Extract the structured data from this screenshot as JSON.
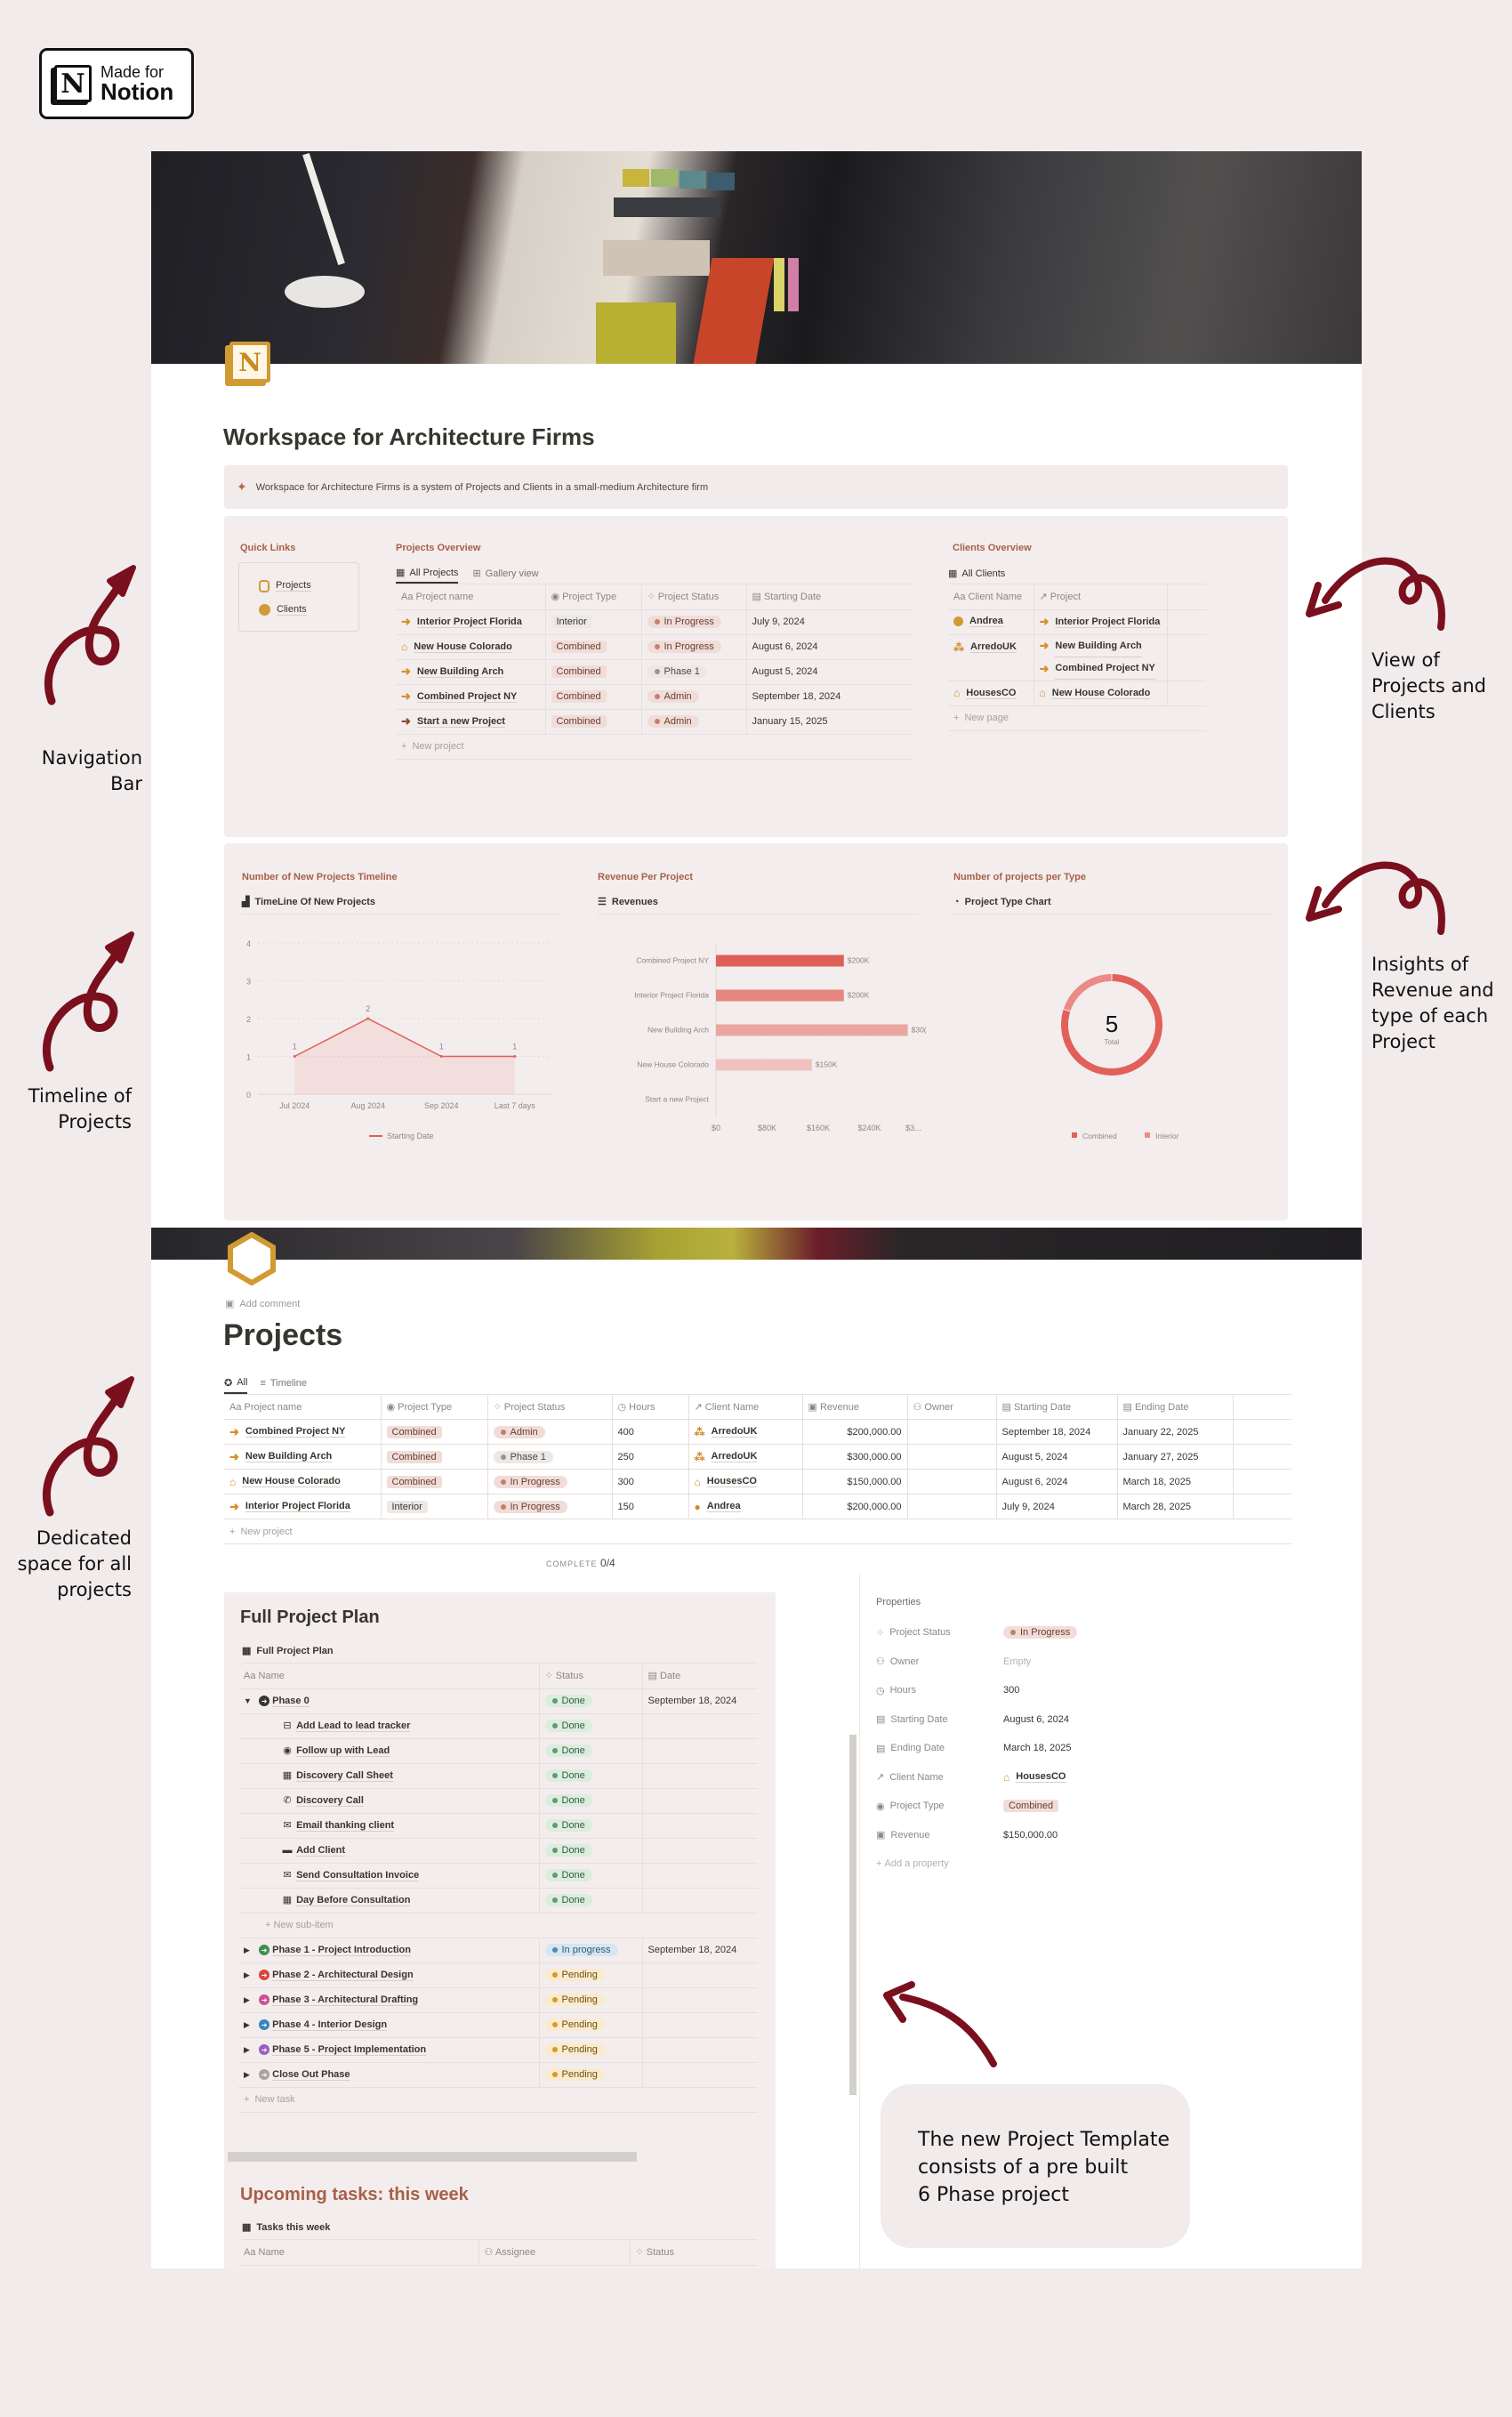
{
  "badge": {
    "line1": "Made for",
    "line2": "Notion",
    "logo": "N"
  },
  "workspace": {
    "page_icon": "N",
    "title": "Workspace for Architecture Firms",
    "callout_icon": "sparkles-icon",
    "callout": "Workspace for Architecture Firms is a system of Projects and Clients in a small-medium Architecture firm",
    "quick_links": {
      "label": "Quick Links",
      "items": [
        {
          "label": "Projects",
          "icon": "hexagon-icon"
        },
        {
          "label": "Clients",
          "icon": "person-icon"
        }
      ]
    },
    "projects_overview": {
      "label": "Projects Overview",
      "tabs": [
        {
          "label": "All Projects",
          "icon": "table-icon",
          "active": true
        },
        {
          "label": "Gallery view",
          "icon": "gallery-icon",
          "active": false
        }
      ],
      "columns": [
        "Project name",
        "Project Type",
        "Project Status",
        "Starting Date"
      ],
      "rows": [
        {
          "name": "Interior Project Florida",
          "icon": "arrow-right-icon",
          "type": "Interior",
          "status": "In Progress",
          "start": "July 9, 2024"
        },
        {
          "name": "New House Colorado",
          "icon": "house-icon",
          "type": "Combined",
          "status": "In Progress",
          "start": "August 6, 2024"
        },
        {
          "name": "New Building Arch",
          "icon": "arrow-right-icon",
          "type": "Combined",
          "status": "Phase 1",
          "start": "August 5, 2024"
        },
        {
          "name": "Combined Project NY",
          "icon": "arrow-right-icon",
          "type": "Combined",
          "status": "Admin",
          "start": "September 18, 2024"
        },
        {
          "name": "Start a new Project",
          "icon": "arrow-right-icon",
          "type": "Combined",
          "status": "Admin",
          "start": "January 15, 2025"
        }
      ],
      "new_label": "New project"
    },
    "clients_overview": {
      "label": "Clients Overview",
      "tab": "All Clients",
      "columns": [
        "Client Name",
        "Project"
      ],
      "rows": [
        {
          "name": "Andrea",
          "icon": "person-icon",
          "projects": [
            "Interior Project Florida"
          ]
        },
        {
          "name": "ArredoUK",
          "icon": "team-icon",
          "projects": [
            "New Building Arch",
            "Combined Project NY"
          ]
        },
        {
          "name": "HousesCO",
          "icon": "home-icon",
          "projects": [
            "New House Colorado"
          ]
        }
      ],
      "new_label": "New page"
    }
  },
  "charts": {
    "timeline": {
      "section": "Number of New Projects Timeline",
      "title": "TimeLine Of New Projects",
      "legend": "Starting Date"
    },
    "revenue": {
      "section": "Revenue Per Project",
      "title": "Revenues"
    },
    "type": {
      "section": "Number of projects per Type",
      "title": "Project Type Chart",
      "center_value": "5",
      "center_label": "Total"
    }
  },
  "chart_data": [
    {
      "type": "area",
      "title": "TimeLine Of New Projects",
      "categories": [
        "Jul 2024",
        "Aug 2024",
        "Sep 2024",
        "Last 7 days"
      ],
      "series": [
        {
          "name": "Starting Date",
          "values": [
            1,
            2,
            1,
            1
          ]
        }
      ],
      "yticks": [
        0,
        1,
        2,
        3,
        4
      ],
      "ylim": [
        0,
        4
      ],
      "grid": true,
      "legend": "bottom",
      "color": "#e2605a"
    },
    {
      "type": "bar",
      "orientation": "horizontal",
      "title": "Revenues",
      "categories": [
        "Combined Project NY",
        "Interior Project Florida",
        "New Building Arch",
        "New House Colorado",
        "Start a new Project"
      ],
      "values": [
        200000,
        200000,
        300000,
        150000,
        0
      ],
      "value_labels": [
        "$200K",
        "$200K",
        "$30(",
        "$150K",
        ""
      ],
      "xticks": [
        "$0",
        "$80K",
        "$160K",
        "$240K",
        "$3..."
      ],
      "xlim": [
        0,
        320000
      ],
      "colors": [
        "#df5f58",
        "#e5877f",
        "#eaa5a0",
        "#f0c2bf",
        "#f3d6d4"
      ]
    },
    {
      "type": "pie",
      "donut": true,
      "title": "Project Type Chart",
      "categories": [
        "Combined",
        "Interior"
      ],
      "values": [
        4,
        1
      ],
      "total": 5,
      "colors": [
        "#e2605a",
        "#ea8b85"
      ],
      "legend": "bottom"
    }
  ],
  "projects_page": {
    "add_comment": "Add comment",
    "title": "Projects",
    "tabs": [
      {
        "label": "All",
        "icon": "star-icon",
        "active": true
      },
      {
        "label": "Timeline",
        "icon": "timeline-icon",
        "active": false
      }
    ],
    "columns": [
      "Project name",
      "Project Type",
      "Project Status",
      "Hours",
      "Client Name",
      "Revenue",
      "Owner",
      "Starting Date",
      "Ending Date"
    ],
    "rows": [
      {
        "name": "Combined Project NY",
        "icon": "arrow-right-icon",
        "type": "Combined",
        "status": "Admin",
        "hours": "400",
        "client": "ArredoUK",
        "client_icon": "team-icon",
        "revenue": "$200,000.00",
        "owner": "",
        "start": "September 18, 2024",
        "end": "January 22, 2025"
      },
      {
        "name": "New Building Arch",
        "icon": "arrow-right-icon",
        "type": "Combined",
        "status": "Phase 1",
        "hours": "250",
        "client": "ArredoUK",
        "client_icon": "team-icon",
        "revenue": "$300,000.00",
        "owner": "",
        "start": "August 5, 2024",
        "end": "January 27, 2025"
      },
      {
        "name": "New House Colorado",
        "icon": "house-icon",
        "type": "Combined",
        "status": "In Progress",
        "hours": "300",
        "client": "HousesCO",
        "client_icon": "home-icon",
        "revenue": "$150,000.00",
        "owner": "",
        "start": "August 6, 2024",
        "end": "March 18, 2025"
      },
      {
        "name": "Interior Project Florida",
        "icon": "arrow-right-icon",
        "type": "Interior",
        "status": "In Progress",
        "hours": "150",
        "client": "Andrea",
        "client_icon": "person-icon",
        "revenue": "$200,000.00",
        "owner": "",
        "start": "July 9, 2024",
        "end": "March 28, 2025"
      }
    ],
    "new_label": "New project",
    "complete_label": "COMPLETE",
    "complete_value": "0/4"
  },
  "plan": {
    "title": "Full Project Plan",
    "view": "Full Project Plan",
    "columns": [
      "Name",
      "Status",
      "Date"
    ],
    "phase0": {
      "name": "Phase 0",
      "status": "Done",
      "date": "September 18, 2024"
    },
    "subitems": [
      {
        "name": "Add Lead to lead tracker",
        "icon": "tram-icon",
        "status": "Done"
      },
      {
        "name": "Follow up with Lead",
        "icon": "record-icon",
        "status": "Done"
      },
      {
        "name": "Discovery Call Sheet",
        "icon": "table-icon",
        "status": "Done"
      },
      {
        "name": "Discovery Call",
        "icon": "phone-icon",
        "status": "Done"
      },
      {
        "name": "Email thanking client",
        "icon": "mail-icon",
        "status": "Done"
      },
      {
        "name": "Add Client",
        "icon": "monitor-icon",
        "status": "Done"
      },
      {
        "name": "Send Consultation Invoice",
        "icon": "mail-icon",
        "status": "Done"
      },
      {
        "name": "Day Before Consultation",
        "icon": "calendar-icon",
        "status": "Done"
      }
    ],
    "new_subitem": "New sub-item",
    "phases": [
      {
        "name": "Phase 1 - Project Introduction",
        "color": "#3f8f52",
        "status": "In progress",
        "date": "September 18, 2024"
      },
      {
        "name": "Phase 2 - Architectural Design",
        "color": "#d9463c",
        "status": "Pending",
        "date": ""
      },
      {
        "name": "Phase 3 - Architectural Drafting",
        "color": "#cf4f92",
        "status": "Pending",
        "date": ""
      },
      {
        "name": "Phase 4 - Interior Design",
        "color": "#3a85bd",
        "status": "Pending",
        "date": ""
      },
      {
        "name": "Phase 5 - Project Implementation",
        "color": "#9a5ec2",
        "status": "Pending",
        "date": ""
      },
      {
        "name": "Close Out Phase",
        "color": "#aaa49f",
        "status": "Pending",
        "date": ""
      }
    ],
    "new_task": "New task",
    "upcoming_title": "Upcoming tasks: this week",
    "upcoming_view": "Tasks this week",
    "upcoming_columns": [
      "Name",
      "Assignee",
      "Status"
    ]
  },
  "properties": {
    "label": "Properties",
    "items": [
      {
        "key": "Project Status",
        "value": "In Progress",
        "kind": "pill"
      },
      {
        "key": "Owner",
        "value": "Empty",
        "kind": "empty"
      },
      {
        "key": "Hours",
        "value": "300",
        "kind": "text"
      },
      {
        "key": "Starting Date",
        "value": "August 6, 2024",
        "kind": "text"
      },
      {
        "key": "Ending Date",
        "value": "March 18, 2025",
        "kind": "text"
      },
      {
        "key": "Client Name",
        "value": "HousesCO",
        "kind": "relation"
      },
      {
        "key": "Project Type",
        "value": "Combined",
        "kind": "tag"
      },
      {
        "key": "Revenue",
        "value": "$150,000.00",
        "kind": "text"
      }
    ],
    "add_label": "Add a property"
  },
  "annotations": {
    "nav": "Navigation\nBar",
    "timeline": "Timeline of\nProjects",
    "dedicated": "Dedicated\nspace for all\nprojects",
    "view": "View of\nProjects and\nClients",
    "insights": "Insights of\nRevenue and\ntype of each\nProject",
    "template": "The new Project Template\nconsists of a pre built\n6 Phase project"
  },
  "colors": {
    "accent_text": "#a8604a",
    "arrow": "#7a0f1e",
    "background": "#f1ebeb"
  }
}
